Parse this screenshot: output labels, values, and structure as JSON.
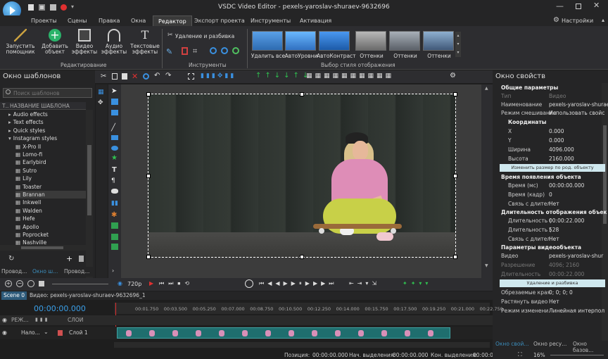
{
  "app": {
    "title": "VSDC Video Editor - pexels-yaroslav-shuraev-9632696",
    "settings_label": "Настройки"
  },
  "menu": {
    "items": [
      "Проекты",
      "Сцены",
      "Правка",
      "Окна",
      "Редактор",
      "Экспорт проекта",
      "Инструменты",
      "Активация"
    ],
    "active": "Редактор"
  },
  "ribbon": {
    "launch": "Запустить помощник",
    "add_object": "Добавить объект",
    "video_effects": "Видео эффекты",
    "audio_effects": "Аудио эффекты",
    "text_effects": "Текстовые эффекты",
    "group_edit": "Редактирование",
    "delete_split": "Удаление и разбивка",
    "group_tools": "Инструменты",
    "group_styles": "Выбор стиля отображения",
    "styles": [
      "Удалить все",
      "АвтоУровни",
      "АвтоКонтраст",
      "Оттенки",
      "Оттенки",
      "Оттенки"
    ]
  },
  "left_panel": {
    "title": "Окно шаблонов",
    "search_placeholder": "Поиск шаблонов",
    "col_t": "Т..",
    "col_name": "НАЗВАНИЕ ШАБЛОНА",
    "items": [
      "Audio effects",
      "Text effects",
      "Quick styles",
      "Instagram styles",
      "X-Pro II",
      "Lomo-fi",
      "Earlybird",
      "Sutro",
      "Lily",
      "Toaster",
      "Brannan",
      "Inkwell",
      "Walden",
      "Hefe",
      "Apollo",
      "Poprocket",
      "Nashville"
    ],
    "tabs": [
      "Провод...",
      "Окно ш...",
      "Провод..."
    ]
  },
  "properties": {
    "title": "Окно свойств",
    "general": "Общие параметры",
    "type_k": "Тип",
    "type_v": "Видео",
    "name_k": "Наименование",
    "name_v": "pexels-yaroslav-shurae",
    "blend_k": "Режим смешивания",
    "blend_v": "Использовать свойс",
    "coords": "Координаты",
    "x_k": "X",
    "x_v": "0.000",
    "y_k": "Y",
    "y_v": "0.000",
    "w_k": "Ширина",
    "w_v": "4096.000",
    "h_k": "Высота",
    "h_v": "2160.000",
    "resize_btn": "Изменить размер по род. объекту",
    "appear": "Время появления объекта",
    "time_ms_k": "Время (мс)",
    "time_ms_v": "00:00:00.000",
    "time_fr_k": "Время (кадр)",
    "time_fr_v": "0",
    "link1_k": "Связь с длител",
    "link1_v": "Нет",
    "duration": "Длительность отображения объек",
    "dur_k": "Длительность (",
    "dur_v": "00:00:22.000",
    "dur_fr_k": "Длительность (",
    "dur_fr_v": "528",
    "link2_k": "Связь с длител",
    "link2_v": "Нет",
    "video_params": "Параметры видеообъекта",
    "video_k": "Видео",
    "video_v": "pexels-yaroslav-shur",
    "res_k": "Разрешение",
    "res_v": "4096; 2160",
    "len_k": "Длительность",
    "len_v": "00:00:22.000",
    "del_btn": "Удаление и разбивка",
    "crop_k": "Обрезаемые края",
    "crop_v": "0; 0; 0; 0",
    "stretch_k": "Растянуть видео",
    "stretch_v": "Нет",
    "mode_k": "Режим изменени",
    "mode_v": "Линейная интерпол",
    "tabs": [
      "Окно свой...",
      "Окно ресу...",
      "Окно базов..."
    ]
  },
  "timeline": {
    "resolution": "720p",
    "scene_tab": "Scene 0",
    "breadcrumb": "Видео: pexels-yaroslav-shuraev-9632696_1",
    "time": "00:00:00.000",
    "ruler": [
      "00:01.750",
      "00:03.500",
      "00:05.250",
      "00:07.000",
      "00:08.750",
      "00:10.500",
      "00:12.250",
      "00:14.000",
      "00:15.750",
      "00:17.500",
      "00:19.250",
      "00:21.000",
      "00:22.750"
    ],
    "mode_label": "РЕЖ...",
    "layers_label": "СЛОИ",
    "track_blend": "Нало...",
    "track_name": "Слой 1"
  },
  "status": {
    "pos_label": "Позиция:",
    "pos_value": "00:00:00.000",
    "sel_start_label": "Нач. выделения:",
    "sel_start_value": "00:00:00.000",
    "sel_end_label": "Кон. выделения:",
    "sel_end_value": "00:00:00.000",
    "zoom": "16%"
  },
  "colors": {
    "accent": "#3a7fc4",
    "track": "#1f6e6e",
    "tab_active": "#3c8dbc"
  }
}
